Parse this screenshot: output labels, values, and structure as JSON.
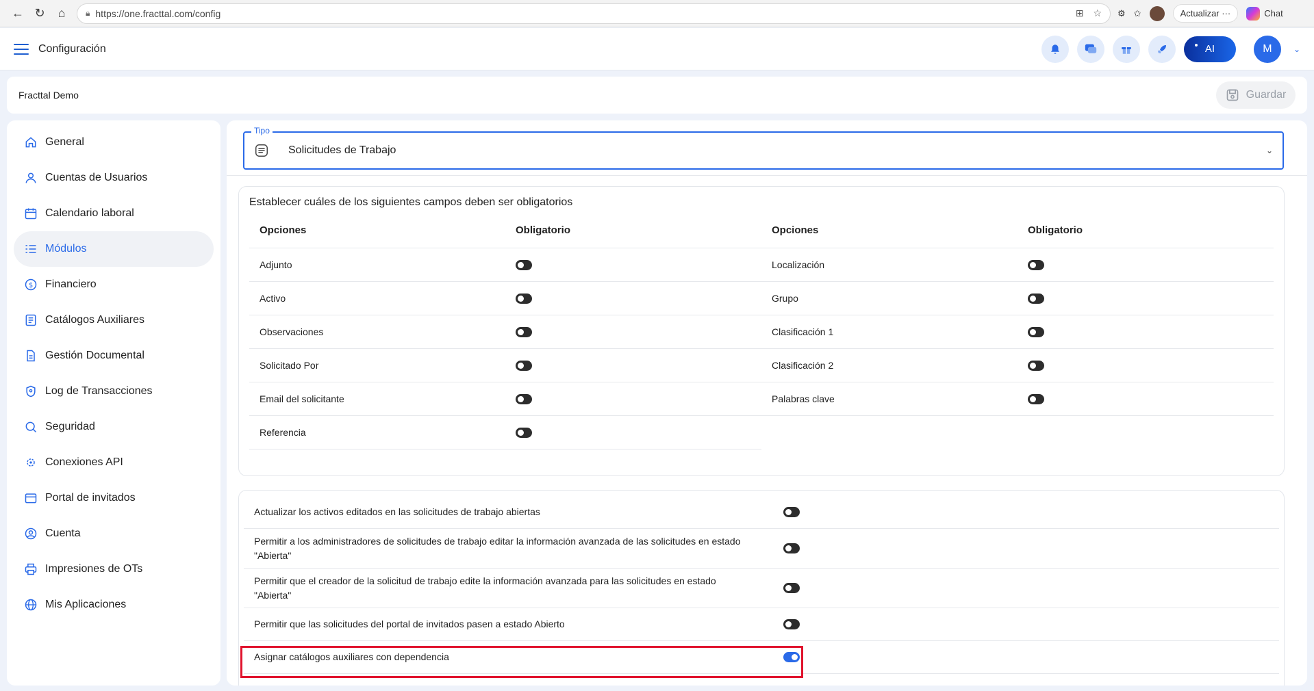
{
  "browser": {
    "url": "https://one.fracttal.com/config",
    "update_label": "Actualizar",
    "chat_label": "Chat"
  },
  "header": {
    "title": "Configuración",
    "ai_label": "AI",
    "avatar_initial": "M"
  },
  "company": {
    "name": "Fracttal Demo",
    "save_label": "Guardar"
  },
  "sidebar": {
    "items": [
      {
        "label": "General",
        "icon": "home-icon"
      },
      {
        "label": "Cuentas de Usuarios",
        "icon": "user-icon"
      },
      {
        "label": "Calendario laboral",
        "icon": "calendar-icon"
      },
      {
        "label": "Módulos",
        "icon": "modules-icon",
        "active": true
      },
      {
        "label": "Financiero",
        "icon": "dollar-icon"
      },
      {
        "label": "Catálogos Auxiliares",
        "icon": "catalog-icon"
      },
      {
        "label": "Gestión Documental",
        "icon": "document-icon"
      },
      {
        "label": "Log de Transacciones",
        "icon": "log-icon"
      },
      {
        "label": "Seguridad",
        "icon": "shield-icon"
      },
      {
        "label": "Conexiones API",
        "icon": "api-icon"
      },
      {
        "label": "Portal de invitados",
        "icon": "portal-icon"
      },
      {
        "label": "Cuenta",
        "icon": "account-icon"
      },
      {
        "label": "Impresiones de OTs",
        "icon": "printer-icon"
      },
      {
        "label": "Mis Aplicaciones",
        "icon": "globe-icon"
      }
    ]
  },
  "tipo": {
    "label": "Tipo",
    "value": "Solicitudes de Trabajo"
  },
  "required_fields": {
    "title": "Establecer cuáles de los siguientes campos deben ser obligatorios",
    "col_options": "Opciones",
    "col_required": "Obligatorio",
    "left": [
      {
        "label": "Adjunto",
        "on": false
      },
      {
        "label": "Activo",
        "on": false
      },
      {
        "label": "Observaciones",
        "on": false
      },
      {
        "label": "Solicitado Por",
        "on": false
      },
      {
        "label": "Email del solicitante",
        "on": false
      },
      {
        "label": "Referencia",
        "on": false
      }
    ],
    "right": [
      {
        "label": "Localización",
        "on": false
      },
      {
        "label": "Grupo",
        "on": false
      },
      {
        "label": "Clasificación 1",
        "on": false
      },
      {
        "label": "Clasificación 2",
        "on": false
      },
      {
        "label": "Palabras clave",
        "on": false
      }
    ]
  },
  "settings": [
    {
      "label": "Actualizar los activos editados en las solicitudes de trabajo abiertas",
      "on": false
    },
    {
      "label": "Permitir a los administradores de solicitudes de trabajo editar la información avanzada de las solicitudes en estado \"Abierta\"",
      "on": false
    },
    {
      "label": "Permitir que el creador de la solicitud de trabajo edite la información avanzada para las solicitudes en estado \"Abierta\"",
      "on": false
    },
    {
      "label": "Permitir que las solicitudes del portal de invitados pasen a estado Abierto",
      "on": false
    },
    {
      "label": "Asignar catálogos auxiliares con dependencia",
      "on": true
    }
  ],
  "colors": {
    "accent": "#2a6ae8",
    "highlight": "#e0142e",
    "toggle_off": "#2d2d2d"
  }
}
